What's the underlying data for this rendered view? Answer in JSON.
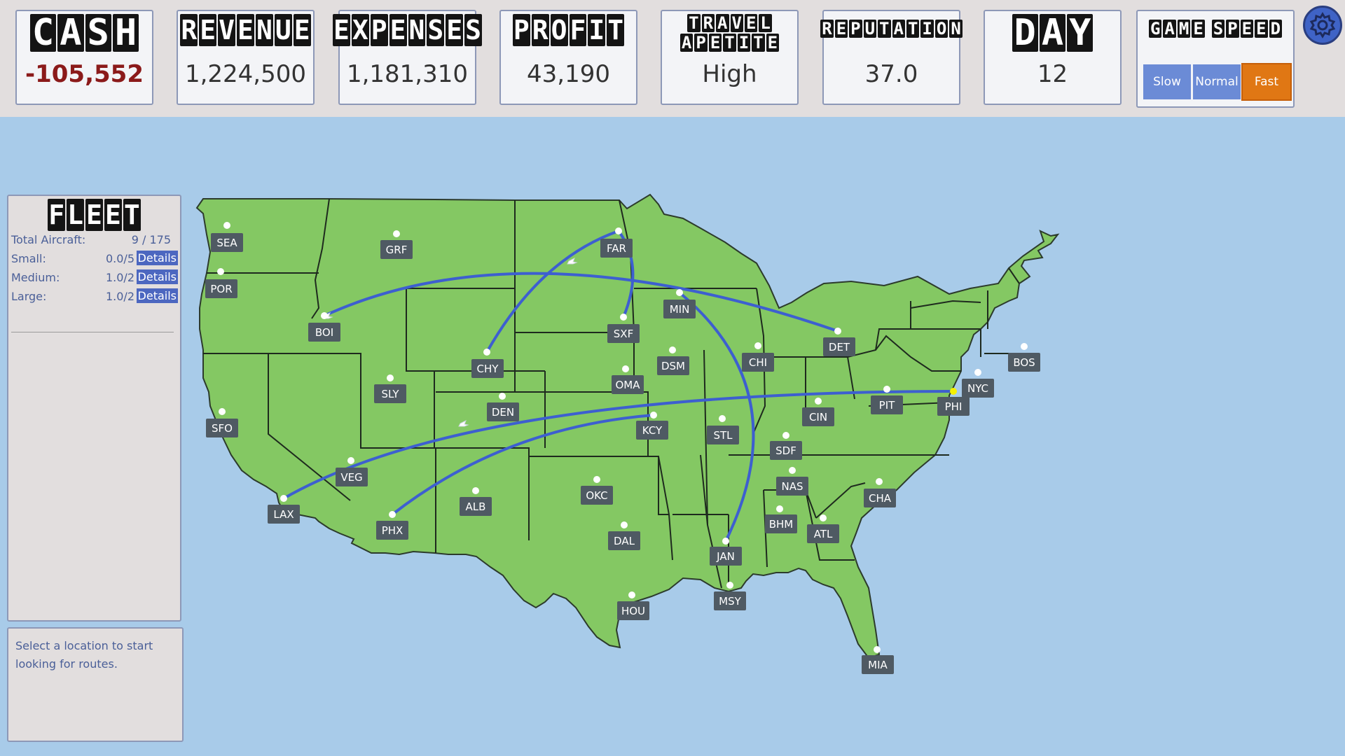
{
  "stats": {
    "cash": {
      "title": "CASH",
      "value": "-105,552"
    },
    "revenue": {
      "title": "REVENUE",
      "value": "1,224,500"
    },
    "expenses": {
      "title": "EXPENSES",
      "value": "1,181,310"
    },
    "profit": {
      "title": "PROFIT",
      "value": "43,190"
    },
    "travel": {
      "title_line1": "TRAVEL",
      "title_line2": "APETITE",
      "value": "High"
    },
    "reputation": {
      "title": "REPUTATION",
      "value": "37.0"
    },
    "day": {
      "title": "DAY",
      "value": "12"
    }
  },
  "game_speed": {
    "title": "GAME SPEED",
    "options": [
      "Slow",
      "Normal",
      "Fast"
    ],
    "selected": "Fast",
    "colors": {
      "normal": "#6b8bd6",
      "selected": "#e07714"
    }
  },
  "settings": {
    "icon": "gear-icon"
  },
  "fleet": {
    "title": "FLEET",
    "total_label": "Total Aircraft:",
    "total_value": "9 / 175",
    "rows": [
      {
        "label": "Small:",
        "value": "0.0/5",
        "button": "Details"
      },
      {
        "label": "Medium:",
        "value": "1.0/2",
        "button": "Details"
      },
      {
        "label": "Large:",
        "value": "1.0/2",
        "button": "Details"
      }
    ]
  },
  "info": {
    "text": "Select a location to start looking for routes."
  },
  "map": {
    "colors": {
      "land": "#84c863",
      "ocean": "#a8cbe9",
      "route": "#3d5fd0",
      "selected_city": "#f5f000",
      "label_bg": "#4f5a63"
    },
    "selected_city": "PHI",
    "cities": [
      "SEA",
      "POR",
      "GRF",
      "FAR",
      "BOI",
      "SXF",
      "MIN",
      "DET",
      "CHY",
      "DSM",
      "CHI",
      "BOS",
      "NYC",
      "PHI",
      "PIT",
      "OMA",
      "SLY",
      "DEN",
      "CIN",
      "SFO",
      "KCY",
      "STL",
      "SDF",
      "VEG",
      "NAS",
      "CHA",
      "OKC",
      "LAX",
      "ALB",
      "PHX",
      "BHM",
      "ATL",
      "DAL",
      "JAN",
      "MSY",
      "HOU",
      "MIA"
    ],
    "routes": [
      [
        "BOI",
        "DET"
      ],
      [
        "CHY",
        "FAR"
      ],
      [
        "FAR",
        "SXF"
      ],
      [
        "MIN",
        "JAN"
      ],
      [
        "LAX",
        "PHI"
      ],
      [
        "PHX",
        "KCY"
      ]
    ]
  }
}
